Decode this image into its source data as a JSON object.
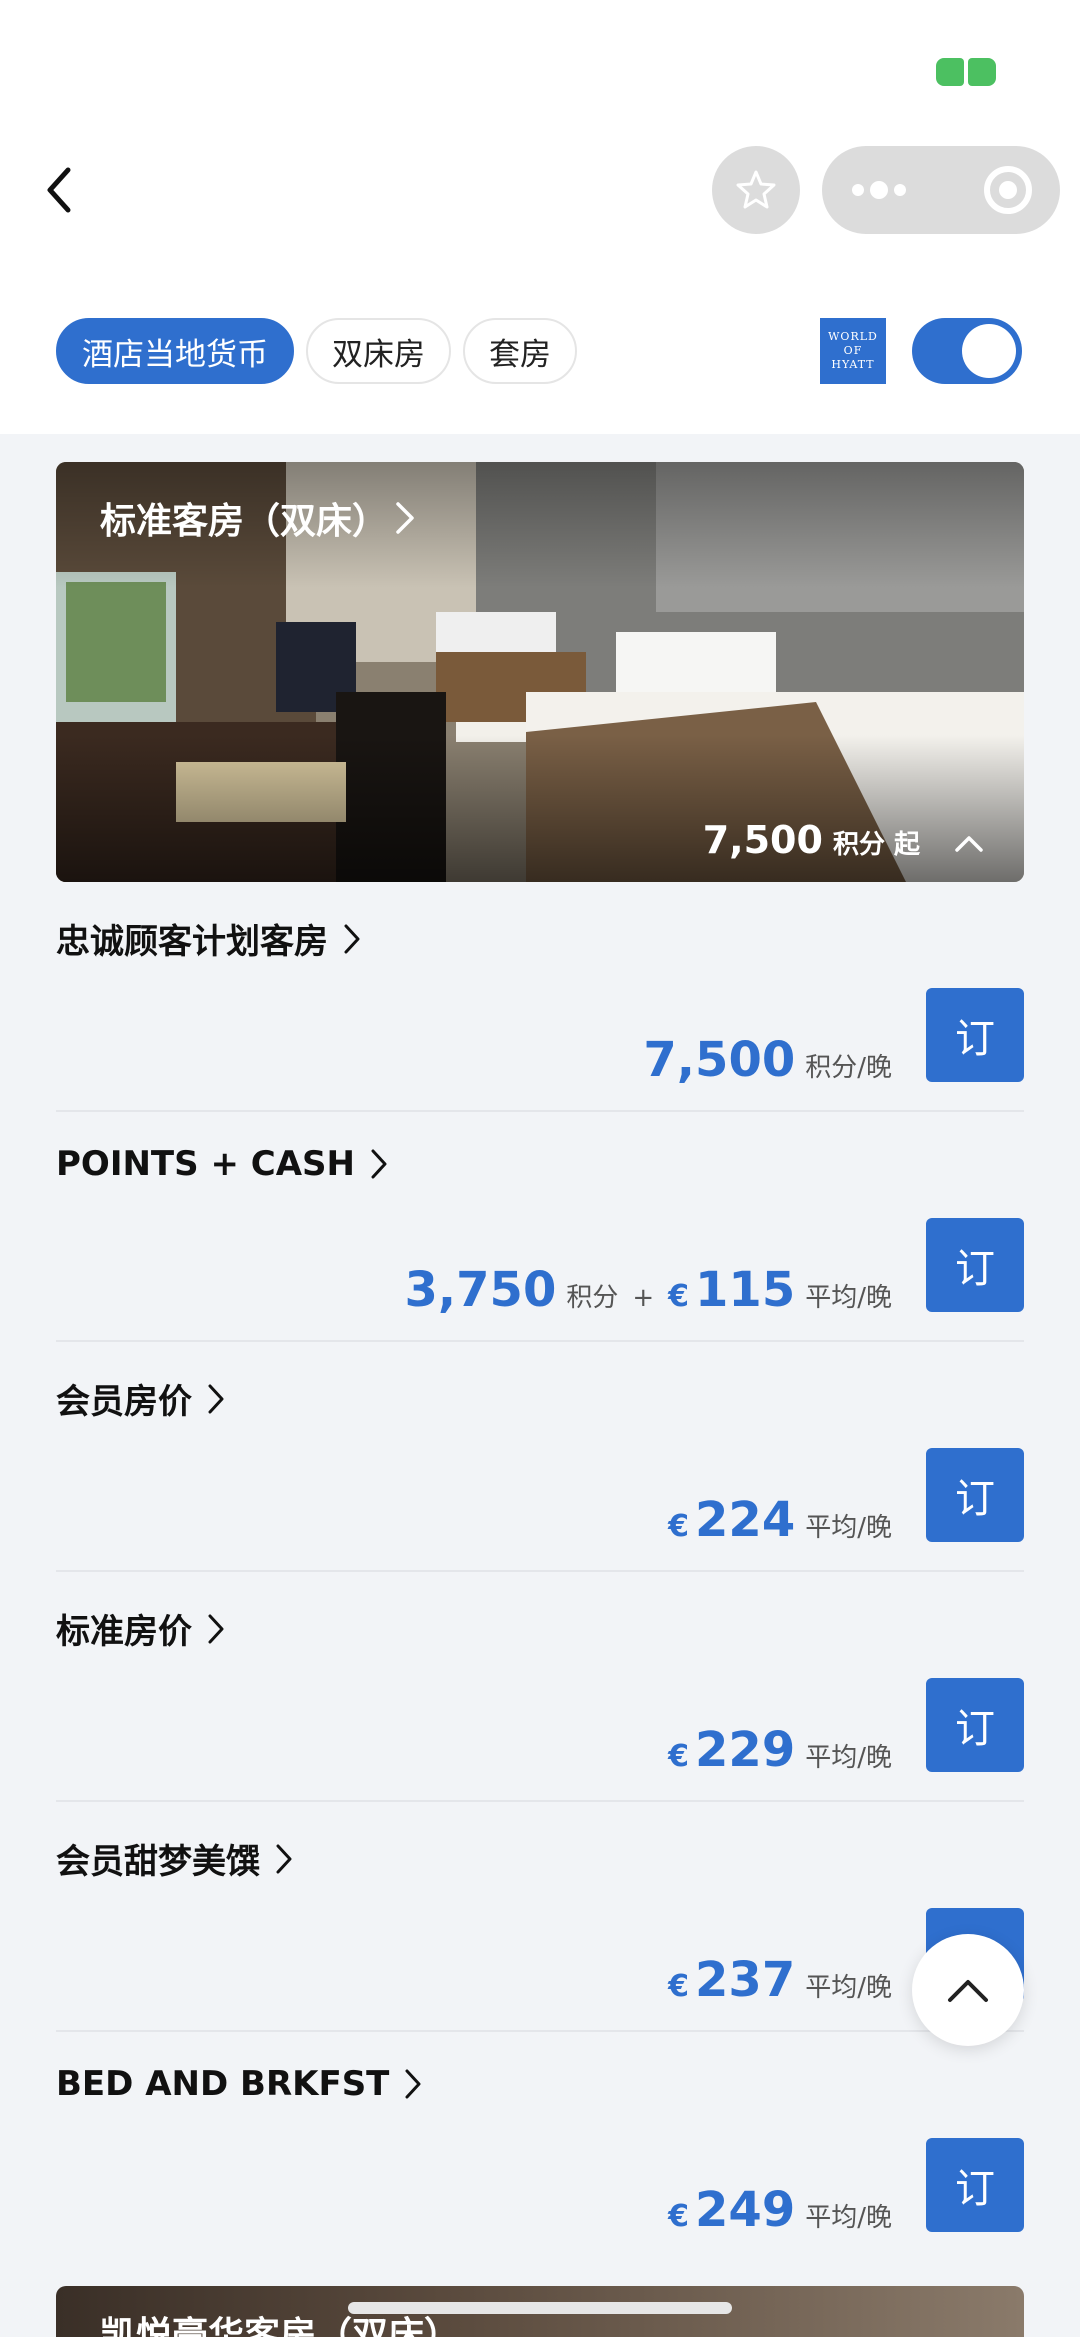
{
  "header": {
    "logo_text": [
      "WORLD",
      "OF",
      "HYATT"
    ]
  },
  "filters": [
    {
      "label": "酒店当地货币",
      "active": true
    },
    {
      "label": "双床房",
      "active": false
    },
    {
      "label": "套房",
      "active": false
    }
  ],
  "toggle_on": true,
  "room": {
    "title": "标准客房（双床）",
    "price_points": "7,500",
    "price_unit": "积分 起"
  },
  "rates": [
    {
      "name": "忠诚顾客计划客房",
      "price": "7,500",
      "price_unit": "积分/晚",
      "book_label": "订"
    },
    {
      "name": "POINTS + CASH",
      "points": "3,750",
      "points_unit": "积分",
      "plus": "+",
      "currency": "€",
      "price": "115",
      "price_unit": "平均/晚",
      "book_label": "订"
    },
    {
      "name": "会员房价",
      "currency": "€",
      "price": "224",
      "price_unit": "平均/晚",
      "book_label": "订"
    },
    {
      "name": "标准房价",
      "currency": "€",
      "price": "229",
      "price_unit": "平均/晚",
      "book_label": "订"
    },
    {
      "name": "会员甜梦美馔",
      "currency": "€",
      "price": "237",
      "price_unit": "平均/晚",
      "book_label": "订"
    },
    {
      "name": "BED AND BRKFST",
      "currency": "€",
      "price": "249",
      "price_unit": "平均/晚",
      "book_label": "订"
    }
  ],
  "next_room": {
    "title": "凯悦豪华客房（双床）"
  },
  "colors": {
    "accent": "#2f6fce",
    "background": "#f2f4f7"
  }
}
